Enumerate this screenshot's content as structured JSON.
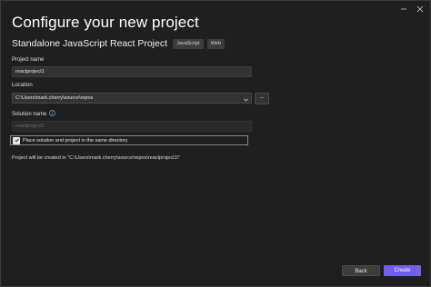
{
  "page": {
    "title": "Configure your new project"
  },
  "template": {
    "name": "Standalone JavaScript React Project",
    "tags": [
      "JavaScript",
      "Web"
    ]
  },
  "project_name": {
    "label": "Project name",
    "value": "reactproject1"
  },
  "location": {
    "label": "Location",
    "value": "C:\\Users\\mark.cherry\\source\\repos",
    "browse_label": "..."
  },
  "solution_name": {
    "label": "Solution name",
    "placeholder": "reactproject1"
  },
  "same_directory": {
    "label": "Place solution and project in the same directory",
    "checked": true
  },
  "created_note": "Project will be created in \"C:\\Users\\mark.cherry\\source\\repos\\reactproject1\\\"",
  "footer": {
    "back_label": "Back",
    "create_label": "Create"
  },
  "colors": {
    "background": "#1f1f1f",
    "accent": "#7160e8",
    "input_bg": "#333333"
  },
  "icons": {
    "minimize": "minimize-icon",
    "close": "close-icon",
    "info": "info-icon",
    "chevron": "chevron-down-icon",
    "check": "checkmark-icon"
  }
}
